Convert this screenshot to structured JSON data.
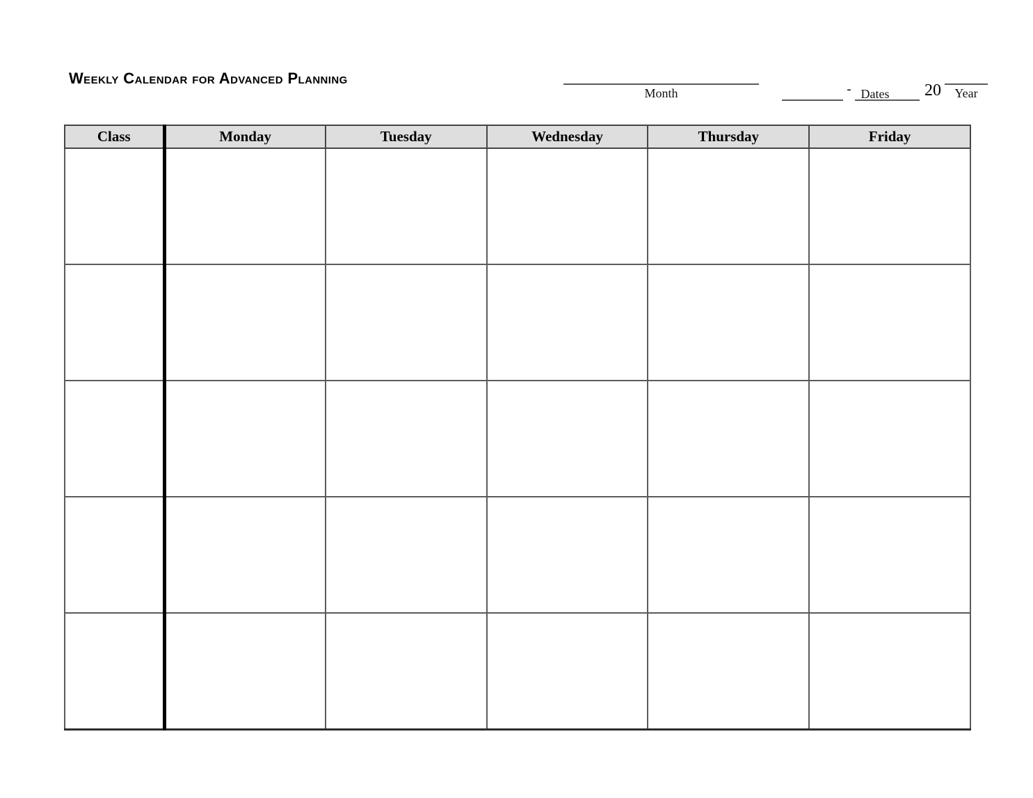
{
  "document": {
    "title": "Weekly Calendar for Advanced Planning"
  },
  "header_fields": {
    "month": {
      "label": "Month",
      "value": ""
    },
    "dates": {
      "label": "Dates",
      "separator": "-",
      "start_value": "",
      "end_value": ""
    },
    "year": {
      "label": "Year",
      "century_prefix": "20",
      "value": ""
    }
  },
  "table": {
    "columns": [
      {
        "key": "class",
        "label": "Class"
      },
      {
        "key": "monday",
        "label": "Monday"
      },
      {
        "key": "tuesday",
        "label": "Tuesday"
      },
      {
        "key": "wednesday",
        "label": "Wednesday"
      },
      {
        "key": "thursday",
        "label": "Thursday"
      },
      {
        "key": "friday",
        "label": "Friday"
      }
    ],
    "rows": [
      {
        "class": "",
        "monday": "",
        "tuesday": "",
        "wednesday": "",
        "thursday": "",
        "friday": ""
      },
      {
        "class": "",
        "monday": "",
        "tuesday": "",
        "wednesday": "",
        "thursday": "",
        "friday": ""
      },
      {
        "class": "",
        "monday": "",
        "tuesday": "",
        "wednesday": "",
        "thursday": "",
        "friday": ""
      },
      {
        "class": "",
        "monday": "",
        "tuesday": "",
        "wednesday": "",
        "thursday": "",
        "friday": ""
      },
      {
        "class": "",
        "monday": "",
        "tuesday": "",
        "wednesday": "",
        "thursday": "",
        "friday": ""
      }
    ],
    "row_count": 5
  },
  "colors": {
    "page_background": "#ffffff",
    "header_row_fill": "#dedede",
    "grid_line": "#5b5b5b",
    "thick_divider": "#000000",
    "text": "#000000"
  }
}
